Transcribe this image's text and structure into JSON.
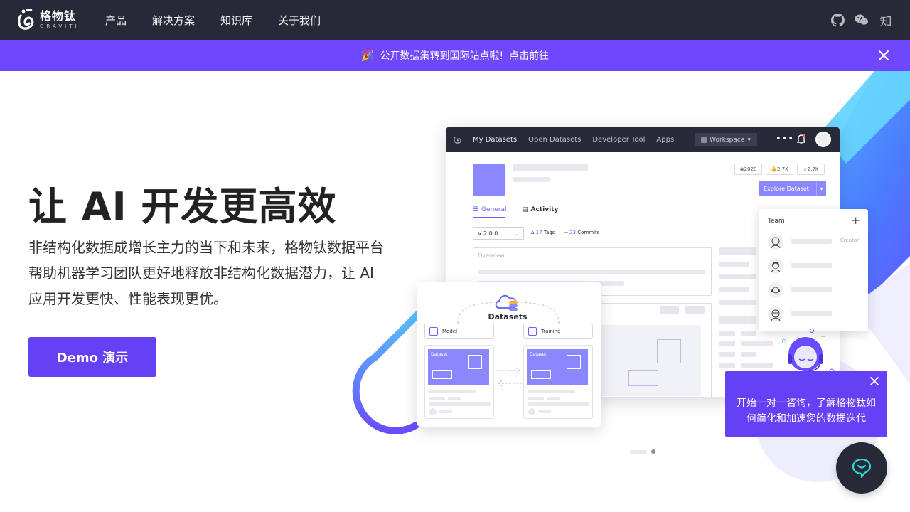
{
  "brand": {
    "name_cn": "格物钛",
    "name_en": "GRAVITI"
  },
  "nav": {
    "items": [
      "产品",
      "解决方案",
      "知识库",
      "关于我们"
    ],
    "right_icons": [
      "github-icon",
      "wechat-icon",
      "zhihu-icon"
    ],
    "zhihu_label": "知"
  },
  "announcement": {
    "emoji": "🎉",
    "text": "公开数据集转到国际站点啦!",
    "link": "点击前往"
  },
  "hero": {
    "title": "让 AI 开发更高效",
    "description": "非结构化数据成增长主力的当下和未来，格物钛数据平台帮助机器学习团队更好地释放非结构化数据潜力，让 AI 应用开发更快、性能表现更优。",
    "cta": "Demo 演示"
  },
  "mockup": {
    "nav": [
      "My Datasets",
      "Open Datasets",
      "Developer Tool",
      "Apps"
    ],
    "workspace": "Workspace",
    "stats": [
      "2020",
      "2.7K",
      "2.7K"
    ],
    "explore_button": "Explore Dataset",
    "tabs": [
      "General",
      "Activity"
    ],
    "version": "V 2.0.0",
    "tags": {
      "count": "17",
      "label": "Tags"
    },
    "commits": {
      "count": "23",
      "label": "Commits"
    },
    "overview_label": "Overview",
    "team": {
      "title": "Team",
      "creator_label": "Creator"
    },
    "datasets_card": {
      "title": "Datasets",
      "model_label": "Model",
      "training_label": "Training",
      "dataset_label": "Dataset"
    }
  },
  "chat": {
    "message": "开始一对一咨询，了解格物钛如何简化和加速您的数据迭代"
  },
  "colors": {
    "nav_bg": "#262936",
    "accent": "#6541f5",
    "banner": "#6e47ff"
  }
}
